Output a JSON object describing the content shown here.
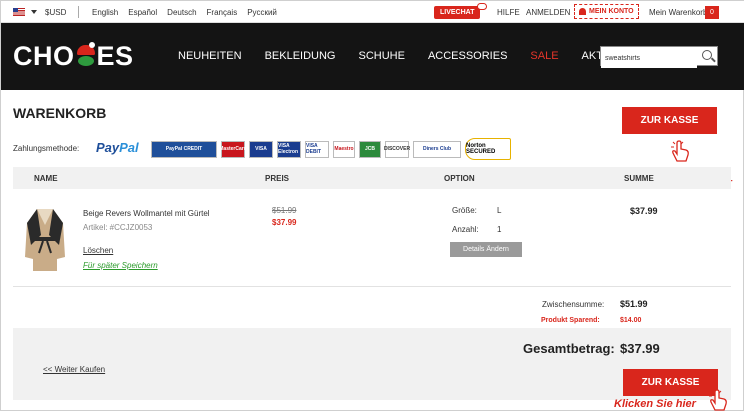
{
  "topbar": {
    "currency": "$USD",
    "languages": [
      "English",
      "Español",
      "Deutsch",
      "Français",
      "Русский"
    ],
    "livechat": "LIVECHAT",
    "help": "HILFE",
    "login": "ANMELDEN",
    "my_account": "MEIN KONTO",
    "cart_label": "Mein Warenkorb",
    "cart_count": "0"
  },
  "header": {
    "logo_left": "CHO",
    "logo_right": "ES",
    "nav": [
      "NEUHEITEN",
      "BEKLEIDUNG",
      "SCHUHE",
      "ACCESSORIES",
      "SALE",
      "AKTIVITÄT"
    ],
    "search_value": "sweatshirts"
  },
  "cart": {
    "title": "WARENKORB",
    "payment_label": "Zahlungsmethode:",
    "paypal": {
      "pay": "Pay",
      "pal": "Pal"
    },
    "cards": [
      "PayPal CREDIT",
      "MasterCard",
      "VISA",
      "VISA Electron",
      "VISA DEBIT",
      "Maestro",
      "JCB",
      "DISCOVER",
      "Diners Club",
      "Norton SECURED"
    ],
    "checkout_label": "ZUR KASSE",
    "click_hint": "Klicken Sie hier",
    "columns": {
      "name": "NAME",
      "price": "PREIS",
      "option": "OPTION",
      "sum": "SUMME"
    },
    "item": {
      "name": "Beige Revers Wollmantel mit Gürtel",
      "article": "Artikel: #CCJZ0053",
      "delete": "Löschen",
      "save_later": "Für später Speichern",
      "old_price": "$51.99",
      "new_price": "$37.99",
      "size_label": "Größe:",
      "size_value": "L",
      "qty_label": "Anzahl:",
      "qty_value": "1",
      "details_button": "Details Ändern",
      "sum": "$37.99"
    },
    "subtotal_label": "Zwischensumme:",
    "subtotal_value": "$51.99",
    "saved_label": "Produkt Sparend:",
    "saved_value": "$14.00",
    "total_label": "Gesamtbetrag:",
    "total_value": "$37.99",
    "continue_shopping": "<< Weiter Kaufen"
  },
  "colors": {
    "accent": "#d9261c",
    "header_bg": "#141414",
    "green": "#2a9a2a"
  }
}
